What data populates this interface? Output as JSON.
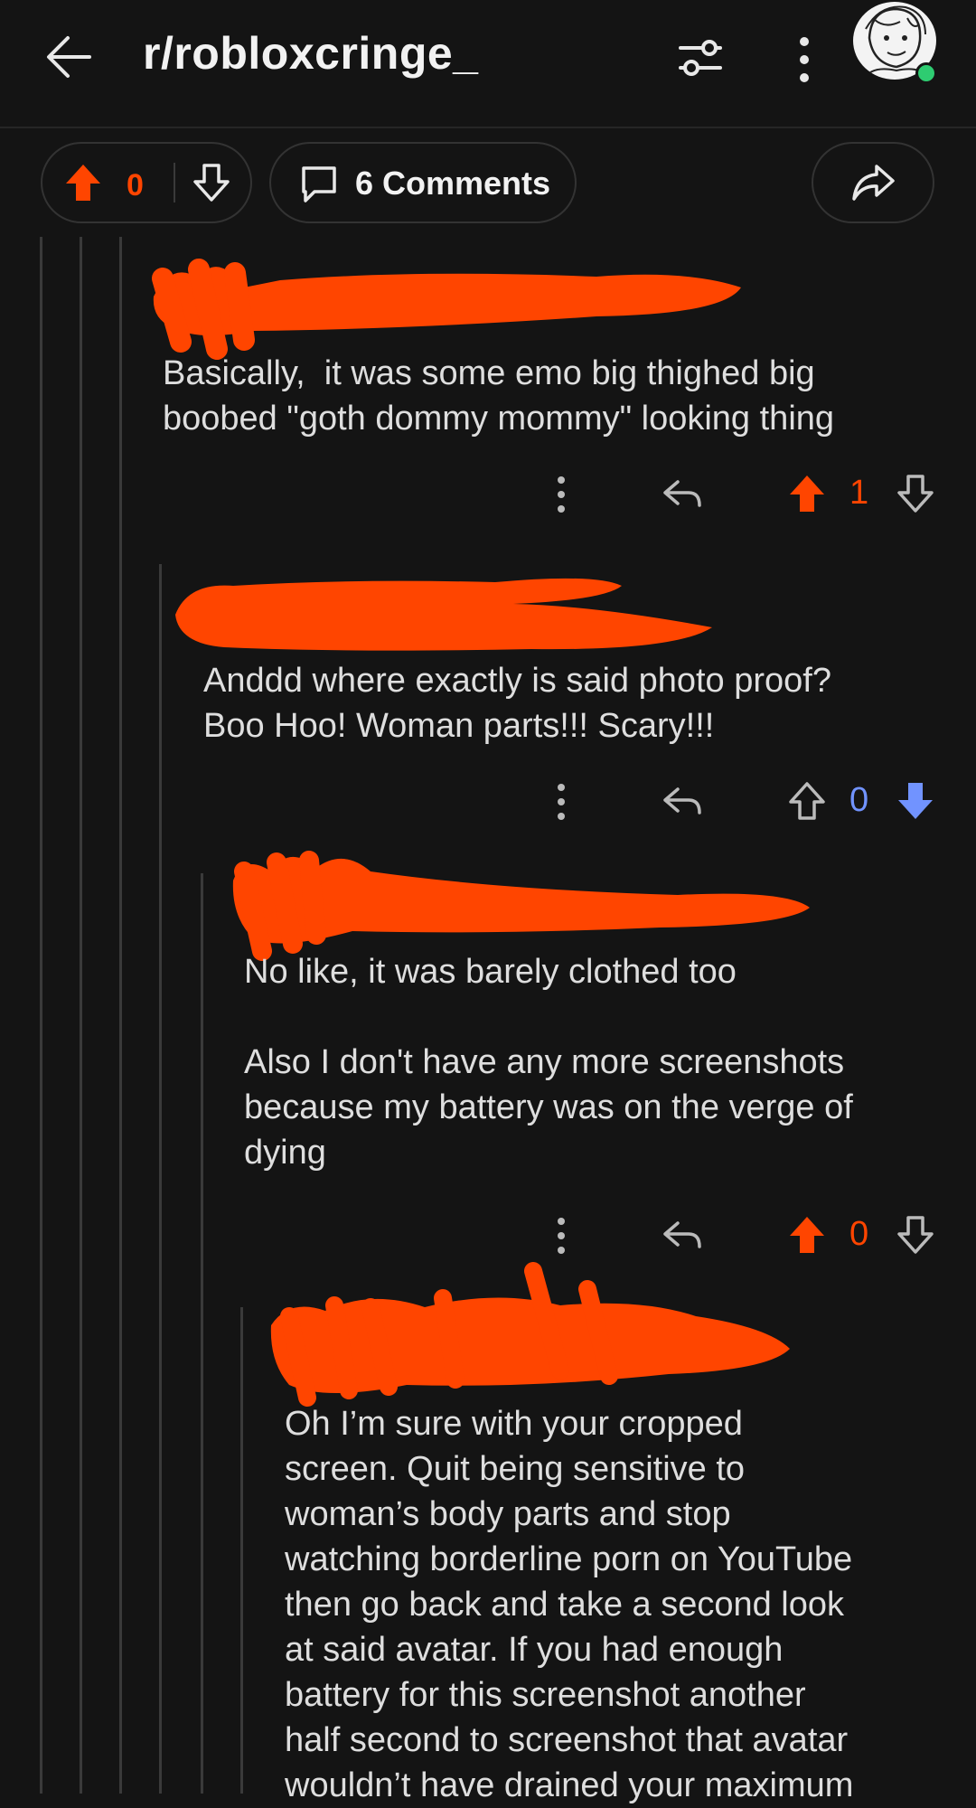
{
  "header": {
    "subreddit": "r/robloxcringe_"
  },
  "post_actions": {
    "vote_count": "0",
    "comments_label": "6 Comments"
  },
  "comments": [
    {
      "text": "Basically,  it was some emo big thighed big\nboobed \"goth dommy mommy\" looking thing",
      "score": "1",
      "vote_state": "upvoted"
    },
    {
      "text": "Anddd where exactly is said photo proof?\nBoo Hoo! Woman parts!!! Scary!!!",
      "score": "0",
      "vote_state": "downvoted"
    },
    {
      "text": "No like, it was barely clothed too\n\nAlso I don't have any more screenshots\nbecause my battery was on the verge of\ndying",
      "score": "0",
      "vote_state": "upvoted"
    },
    {
      "text": "Oh I’m sure with your cropped\nscreen. Quit being sensitive to\nwoman’s body parts and stop\nwatching borderline porn on YouTube\nthen go back and take a second look\nat said avatar. If you had enough\nbattery for this screenshot another\nhalf second to screenshot that avatar\nwouldn’t have drained your maximum"
    }
  ],
  "colors": {
    "background": "#141414",
    "upvote": "#ff4500",
    "downvote": "#7193ff",
    "redaction": "#ff4500"
  }
}
